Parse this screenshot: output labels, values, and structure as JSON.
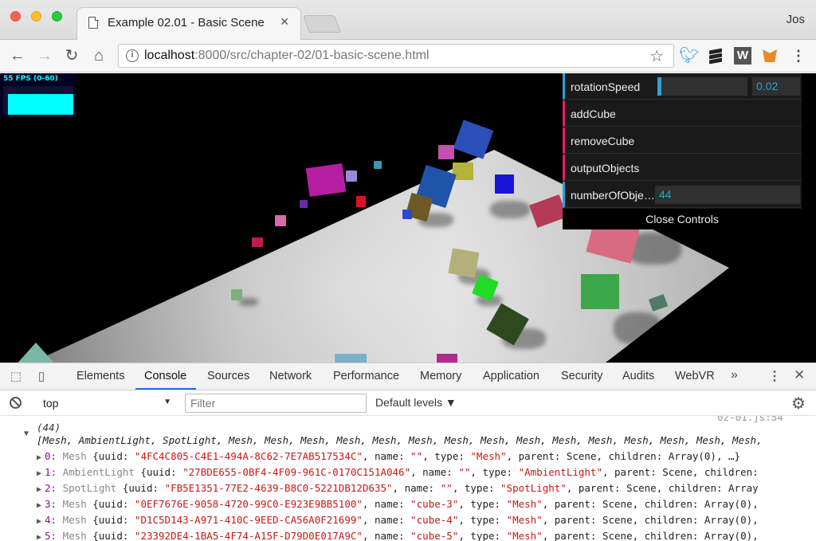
{
  "browser": {
    "tab_title": "Example 02.01 - Basic Scene",
    "tab_close": "✕",
    "profile_name": "Jos",
    "url_host": "localhost",
    "url_rest": ":8000/src/chapter-02/01-basic-scene.html",
    "extensions": [
      "twitter-icon",
      "buffer-icon",
      "w-icon",
      "metamask-fox-icon"
    ],
    "w_label": "W"
  },
  "stats": {
    "fps_label": "55 FPS (0-60)"
  },
  "gui": {
    "rotation_label": "rotationSpeed",
    "rotation_value": "0.02",
    "rotation_fraction": 0.04,
    "add_label": "addCube",
    "remove_label": "removeCube",
    "output_label": "outputObjects",
    "count_label": "numberOfObjects",
    "count_value": "44",
    "close_label": "Close Controls",
    "colors": {
      "number": "#2fa1d6",
      "function": "#e61d5f",
      "background": "#1a1a1a"
    }
  },
  "devtools": {
    "tabs": [
      "Elements",
      "Console",
      "Sources",
      "Network",
      "Performance",
      "Memory",
      "Application",
      "Security",
      "Audits",
      "WebVR"
    ],
    "active_tab": "Console",
    "more": "»",
    "context": "top",
    "filter_placeholder": "Filter",
    "levels": "Default levels ▼",
    "accent": "#1a73e8"
  },
  "console": {
    "timestamp": "02-01.js:54",
    "count": "(44)",
    "summary": "[Mesh, AmbientLight, SpotLight, Mesh, Mesh, Mesh, Mesh, Mesh, Mesh, Mesh, Mesh, Mesh, Mesh, Mesh, Mesh, Mesh, Mesh, Mesh,",
    "entries": [
      {
        "idx": "0:",
        "cls": "Mesh",
        "pre": " {uuid: ",
        "uuid": "\"4FC4C805-C4E1-494A-8C62-7E7AB517534C\"",
        "mid": ", name: ",
        "name": "\"\"",
        "tmid": ", type: ",
        "type": "\"Mesh\"",
        "tail": ", parent: Scene, children: Array(0), …}"
      },
      {
        "idx": "1:",
        "cls": "AmbientLight",
        "pre": " {uuid: ",
        "uuid": "\"27BDE655-0BF4-4F09-961C-0170C151A046\"",
        "mid": ", name: ",
        "name": "\"\"",
        "tmid": ", type: ",
        "type": "\"AmbientLight\"",
        "tail": ", parent: Scene, children:"
      },
      {
        "idx": "2:",
        "cls": "SpotLight",
        "pre": " {uuid: ",
        "uuid": "\"FB5E1351-77E2-4639-B8C0-5221DB12D635\"",
        "mid": ", name: ",
        "name": "\"\"",
        "tmid": ", type: ",
        "type": "\"SpotLight\"",
        "tail": ", parent: Scene, children: Array"
      },
      {
        "idx": "3:",
        "cls": "Mesh",
        "pre": " {uuid: ",
        "uuid": "\"0EF7676E-9058-4720-99C0-E923E9BB5100\"",
        "mid": ", name: ",
        "name": "\"cube-3\"",
        "tmid": ", type: ",
        "type": "\"Mesh\"",
        "tail": ", parent: Scene, children: Array(0),"
      },
      {
        "idx": "4:",
        "cls": "Mesh",
        "pre": " {uuid: ",
        "uuid": "\"D1C5D143-A971-410C-9EED-CA56A0F21699\"",
        "mid": ", name: ",
        "name": "\"cube-4\"",
        "tmid": ", type: ",
        "type": "\"Mesh\"",
        "tail": ", parent: Scene, children: Array(0),"
      },
      {
        "idx": "5:",
        "cls": "Mesh",
        "pre": " {uuid: ",
        "uuid": "\"23392DE4-1BA5-4F74-A15F-D79D0E017A9C\"",
        "mid": ", name: ",
        "name": "\"cube-5\"",
        "tmid": ", type: ",
        "type": "\"Mesh\"",
        "tail": ", parent: Scene, children: Array(0),"
      }
    ]
  }
}
